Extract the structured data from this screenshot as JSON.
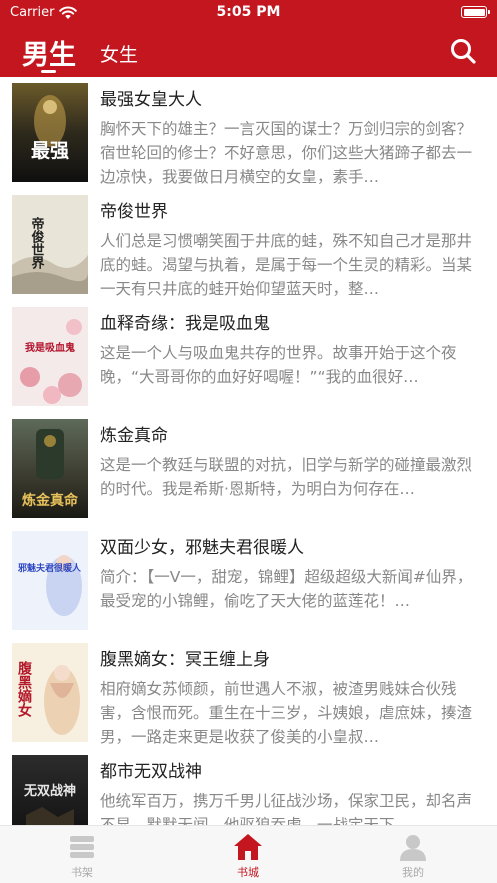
{
  "status_bar": {
    "carrier": "Carrier",
    "time": "5:05 PM"
  },
  "nav": {
    "tabs": [
      {
        "label": "男生",
        "active": true
      },
      {
        "label": "女生",
        "active": false
      }
    ],
    "search_icon": "search-icon"
  },
  "books": [
    {
      "title": "最强女皇大人",
      "description": "胸怀天下的雄主？一言灭国的谋士？万剑归宗的剑客？宿世轮回的修士？不好意思，你们这些大猪蹄子都去一边凉快，我要做日月横空的女皇，素手…",
      "cover_text": "最强"
    },
    {
      "title": "帝俊世界",
      "description": "人们总是习惯嘲笑囿于井底的蛙，殊不知自己才是那井底的蛙。渴望与执着，是属于每一个生灵的精彩。当某一天有只井底的蛙开始仰望蓝天时，整…",
      "cover_text": "帝俊世界"
    },
    {
      "title": "血释奇缘：我是吸血鬼",
      "description": "这是一个人与吸血鬼共存的世界。故事开始于这个夜晚，“大哥哥你的血好好喝喔！”“我的血很好…",
      "cover_text": "我是吸血鬼"
    },
    {
      "title": "炼金真命",
      "description": "这是一个教廷与联盟的对抗，旧学与新学的碰撞最激烈的时代。我是希斯·恩斯特，为明白为何存在…",
      "cover_text": "炼金真命"
    },
    {
      "title": "双面少女，邪魅夫君很暖人",
      "description": "简介：【一V一，甜宠，锦鲤】超级超级大新闻#仙界，最受宠的小锦鲤，偷吃了天大佬的蓝莲花！…",
      "cover_text": "邪魅夫君很暖人"
    },
    {
      "title": "腹黑嫡女：冥王缠上身",
      "description": "相府嫡女苏倾颜，前世遇人不淑，被渣男贱妹合伙残害，含恨而死。重生在十三岁，斗姨娘，虐庶妹，揍渣男，一路走来更是收获了俊美的小皇叔…",
      "cover_text": "腹黑嫡女"
    },
    {
      "title": "都市无双战神",
      "description": "他统军百万，携万千男儿征战沙场，保家卫民，却名声不显，默默无闻，他驱狼吞虎，一战定天下…",
      "cover_text": "无双战神"
    }
  ],
  "tab_bar": {
    "items": [
      {
        "label": "书架",
        "icon": "bookshelf-icon",
        "active": false
      },
      {
        "label": "书城",
        "icon": "bookstore-home-icon",
        "active": true
      },
      {
        "label": "我的",
        "icon": "profile-icon",
        "active": false
      }
    ]
  },
  "colors": {
    "brand": "#c3161f",
    "title_text": "#222222",
    "desc_text": "#888888",
    "tab_inactive": "#aaaaaa"
  }
}
